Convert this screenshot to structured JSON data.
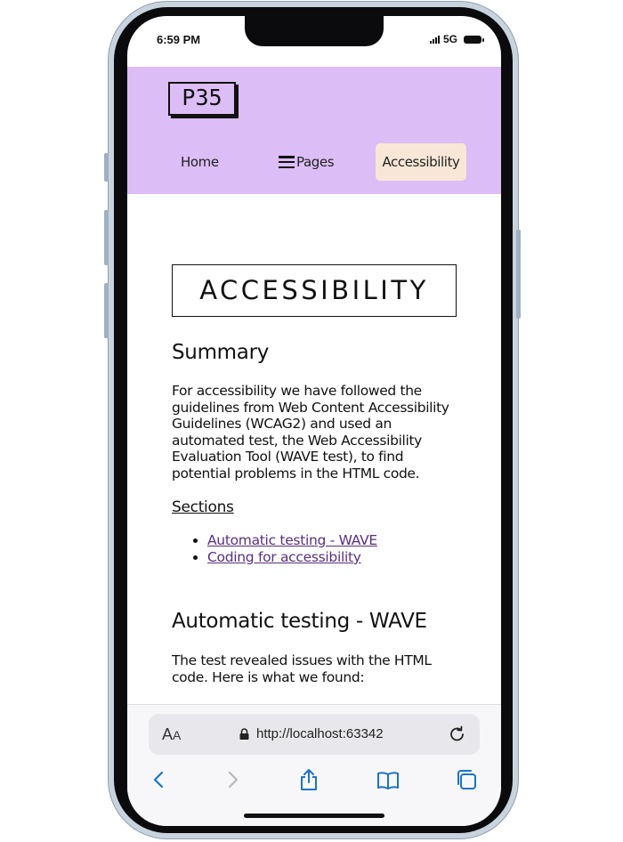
{
  "status_bar": {
    "time": "6:59 PM",
    "network": "5G"
  },
  "site": {
    "logo": "P35",
    "nav": [
      {
        "label": "Home"
      },
      {
        "label": "Pages"
      },
      {
        "label": "Accessibility",
        "active": true
      }
    ]
  },
  "page": {
    "title": "ACCESSIBILITY",
    "summary_heading": "Summary",
    "summary_text": "For accessibility we have followed the guidelines from Web Content Accessibility Guidelines (WCAG2) and used an automated test, the Web Accessibility Evaluation Tool (WAVE test), to find potential problems in the HTML code.",
    "sections_label": "Sections",
    "sections": [
      {
        "label": "Automatic testing - WAVE"
      },
      {
        "label": "Coding for accessibility"
      }
    ],
    "wave_heading": "Automatic testing - WAVE",
    "wave_text": "The test revealed issues with the HTML code. Here is what we found:"
  },
  "browser": {
    "aa_label_big": "A",
    "aa_label_small": "A",
    "url": "http://localhost:63342"
  },
  "colors": {
    "header_bg": "#dcbdf5",
    "active_nav_bg": "#f8e7d6",
    "link": "#5b2e80",
    "browser_accent": "#1a73c9"
  },
  "icons": [
    "lock-icon",
    "reload-icon",
    "back-icon",
    "forward-icon",
    "share-icon",
    "bookmarks-icon",
    "tabs-icon",
    "hamburger-icon"
  ]
}
